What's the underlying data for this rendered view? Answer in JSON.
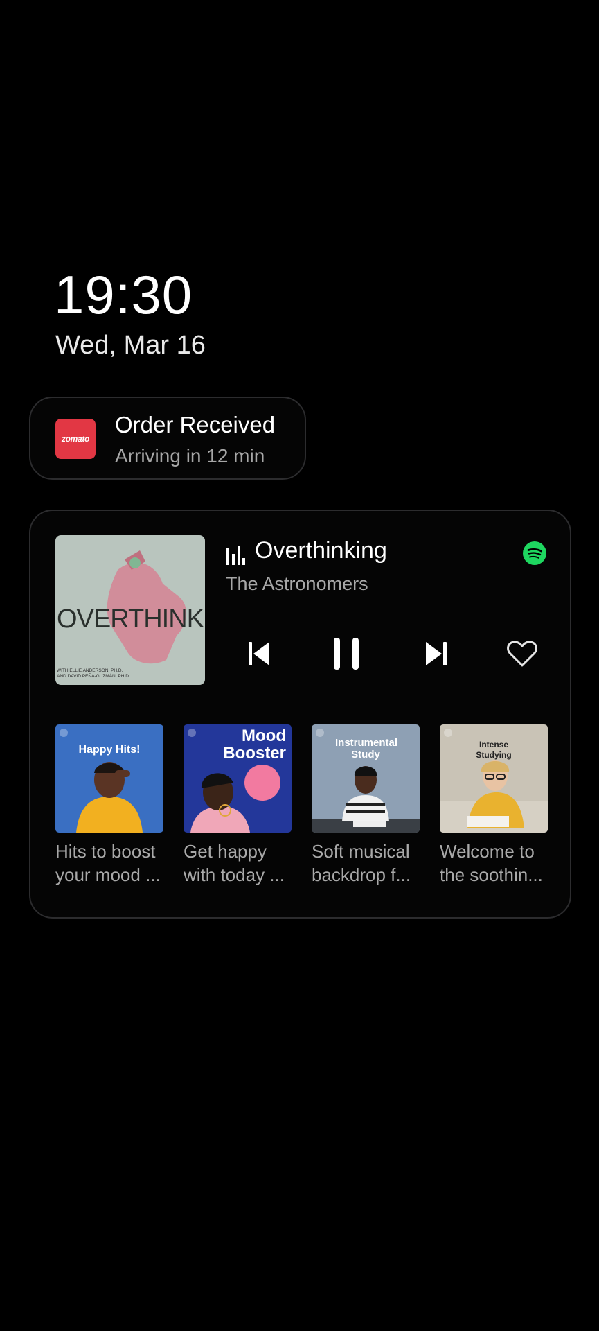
{
  "lockscreen": {
    "time": "19:30",
    "date": "Wed, Mar 16"
  },
  "notification": {
    "app_logo_text": "zomato",
    "title": "Order Received",
    "subtitle": "Arriving in 12 min",
    "brand_color": "#e23744"
  },
  "media": {
    "app_icon": "spotify-icon",
    "track_title": "Overthinking",
    "artist": "The Astronomers",
    "album_art_title": "OVERTHINK",
    "album_art_credits": "WITH ELLIE ANDERSON, PH.D.\nAND DAVID PEÑA-GUZMÁN, PH.D.",
    "controls": [
      "previous-icon",
      "pause-icon",
      "next-icon",
      "heart-icon"
    ],
    "accent_color": "#1ed760"
  },
  "recommendations": [
    {
      "cover_title": "Happy Hits!",
      "description": "Hits to boost\nyour mood ..."
    },
    {
      "cover_title": "Mood Booster",
      "description": "Get happy\nwith today ..."
    },
    {
      "cover_title": "Instrumental Study",
      "description": "Soft musical\nbackdrop f..."
    },
    {
      "cover_title": "Intense Studying",
      "description": "Welcome to\nthe soothin..."
    }
  ]
}
